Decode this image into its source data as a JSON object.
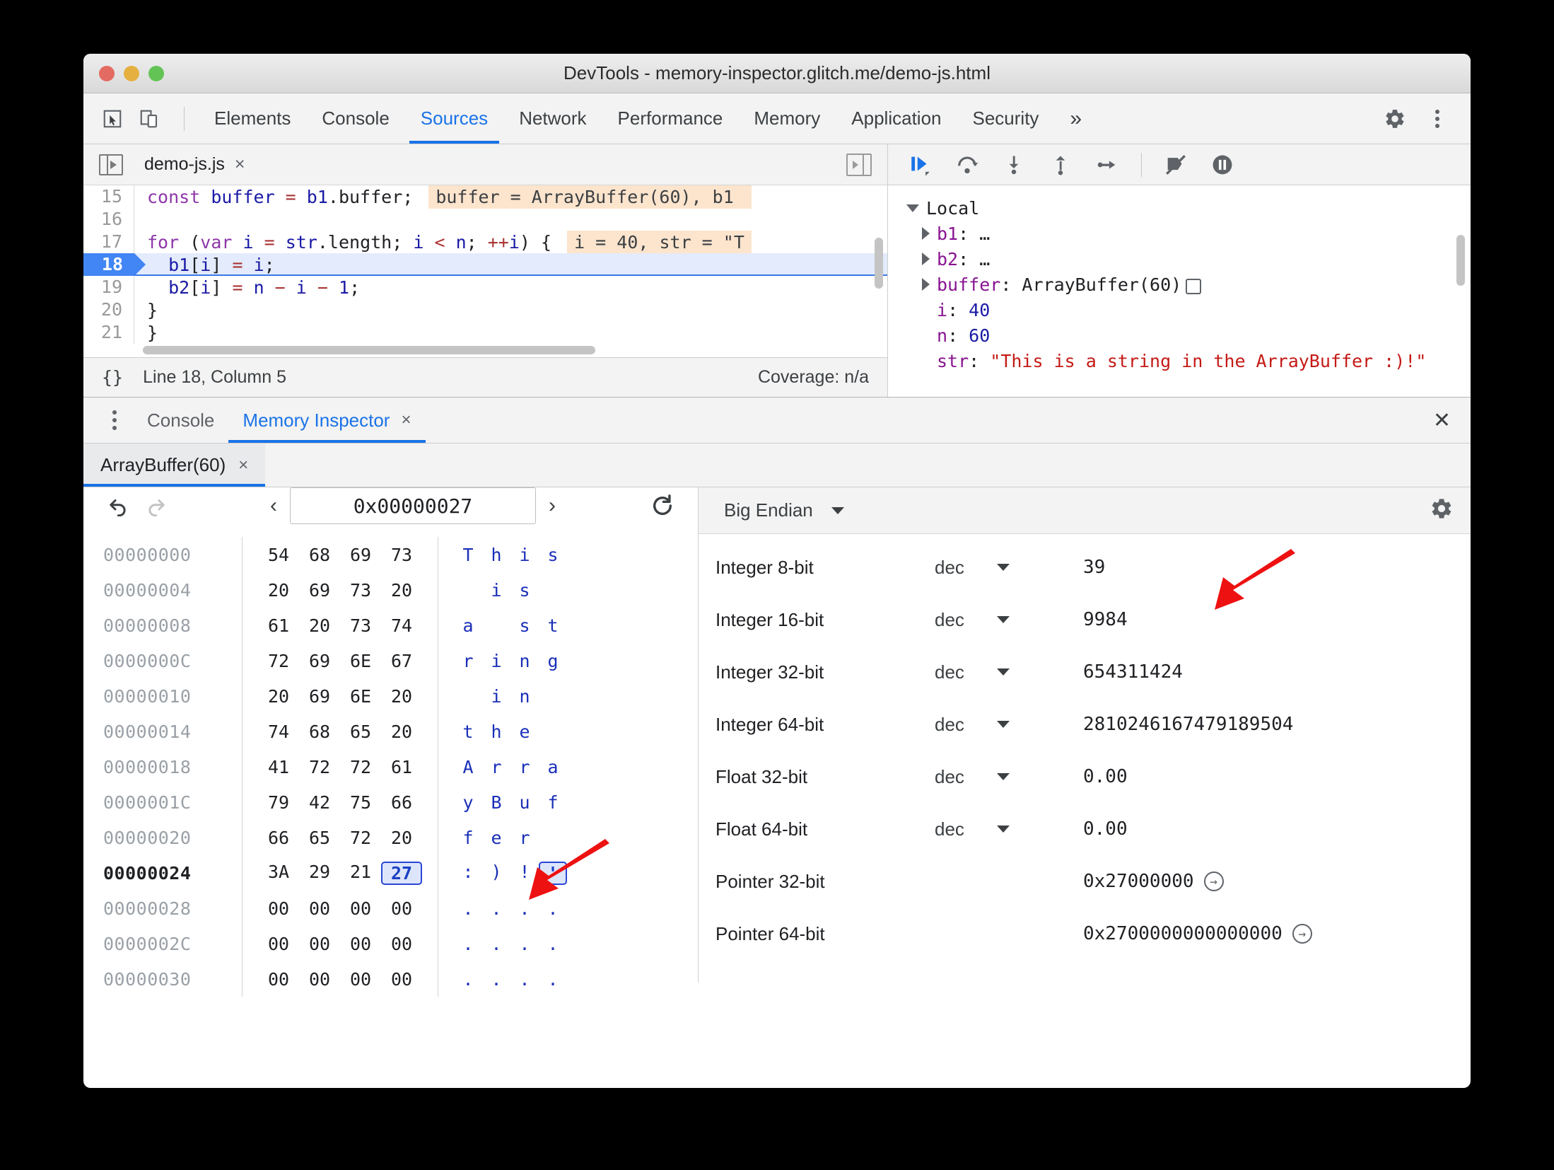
{
  "window": {
    "title": "DevTools - memory-inspector.glitch.me/demo-js.html"
  },
  "toolbar": {
    "inspect_icon": "cursor-select-icon",
    "device_icon": "device-toolbar-icon",
    "tabs": [
      {
        "label": "Elements",
        "active": false
      },
      {
        "label": "Console",
        "active": false
      },
      {
        "label": "Sources",
        "active": true
      },
      {
        "label": "Network",
        "active": false
      },
      {
        "label": "Performance",
        "active": false
      },
      {
        "label": "Memory",
        "active": false
      },
      {
        "label": "Application",
        "active": false
      },
      {
        "label": "Security",
        "active": false
      }
    ],
    "more_tabs": "»",
    "settings_icon": "gear-icon",
    "menu_icon": "kebab-menu-icon"
  },
  "sources": {
    "file_tab": {
      "name": "demo-js.js",
      "close": "×"
    },
    "code_lines": [
      {
        "number": "15",
        "segments": [
          {
            "t": "const ",
            "c": "kw"
          },
          {
            "t": "buffer",
            "c": "var-name"
          },
          {
            "t": " = ",
            "c": "op"
          },
          {
            "t": "b1",
            "c": "var-name"
          },
          {
            "t": ".buffer;",
            "c": "plain"
          }
        ],
        "hint": "buffer = ArrayBuffer(60), b1 ",
        "current": false
      },
      {
        "number": "16",
        "segments": [],
        "hint": "",
        "current": false
      },
      {
        "number": "17",
        "segments": [
          {
            "t": "for ",
            "c": "kw"
          },
          {
            "t": "(",
            "c": "plain"
          },
          {
            "t": "var ",
            "c": "kw"
          },
          {
            "t": "i",
            "c": "var-name"
          },
          {
            "t": " = ",
            "c": "op"
          },
          {
            "t": "str",
            "c": "var-name"
          },
          {
            "t": ".length; ",
            "c": "plain"
          },
          {
            "t": "i",
            "c": "var-name"
          },
          {
            "t": " < ",
            "c": "op"
          },
          {
            "t": "n",
            "c": "var-name"
          },
          {
            "t": "; ",
            "c": "plain"
          },
          {
            "t": "++",
            "c": "op"
          },
          {
            "t": "i",
            "c": "var-name"
          },
          {
            "t": ") {",
            "c": "plain"
          }
        ],
        "hint": "i = 40, str = \"T",
        "current": false
      },
      {
        "number": "18",
        "segments": [
          {
            "t": "  ",
            "c": "plain"
          },
          {
            "t": "b1",
            "c": "var-name"
          },
          {
            "t": "[",
            "c": "plain"
          },
          {
            "t": "i",
            "c": "var-name"
          },
          {
            "t": "] ",
            "c": "plain"
          },
          {
            "t": "= ",
            "c": "op"
          },
          {
            "t": "i",
            "c": "var-name"
          },
          {
            "t": ";",
            "c": "plain"
          }
        ],
        "hint": "",
        "current": true
      },
      {
        "number": "19",
        "segments": [
          {
            "t": "  ",
            "c": "plain"
          },
          {
            "t": "b2",
            "c": "var-name"
          },
          {
            "t": "[",
            "c": "plain"
          },
          {
            "t": "i",
            "c": "var-name"
          },
          {
            "t": "] ",
            "c": "plain"
          },
          {
            "t": "= ",
            "c": "op"
          },
          {
            "t": "n",
            "c": "var-name"
          },
          {
            "t": " − ",
            "c": "op"
          },
          {
            "t": "i",
            "c": "var-name"
          },
          {
            "t": " − ",
            "c": "op"
          },
          {
            "t": "1",
            "c": "num"
          },
          {
            "t": ";",
            "c": "plain"
          }
        ],
        "hint": "",
        "current": false
      },
      {
        "number": "20",
        "segments": [
          {
            "t": "}",
            "c": "plain"
          }
        ],
        "hint": "",
        "current": false
      },
      {
        "number": "21",
        "segments": [
          {
            "t": "}",
            "c": "plain"
          }
        ],
        "hint": "",
        "current": false
      }
    ],
    "status": {
      "format_icon": "{}",
      "position": "Line 18, Column 5",
      "coverage": "Coverage: n/a"
    }
  },
  "debugger": {
    "buttons": [
      "resume-script-icon",
      "step-over-icon",
      "step-into-icon",
      "step-out-icon",
      "step-icon",
      "deactivate-breakpoints-icon",
      "pause-on-exceptions-icon"
    ],
    "scope_title": "Local",
    "scope_rows": [
      {
        "name": "b1",
        "sep": ": ",
        "value": "…",
        "expandable": true,
        "kind": "plain"
      },
      {
        "name": "b2",
        "sep": ": ",
        "value": "…",
        "expandable": true,
        "kind": "plain"
      },
      {
        "name": "buffer",
        "sep": ": ",
        "value": "ArrayBuffer(60)",
        "expandable": true,
        "kind": "plain",
        "memory_icon": true
      },
      {
        "name": "i",
        "sep": ": ",
        "value": "40",
        "expandable": false,
        "kind": "num"
      },
      {
        "name": "n",
        "sep": ": ",
        "value": "60",
        "expandable": false,
        "kind": "num"
      },
      {
        "name": "str",
        "sep": ": ",
        "value": "\"This is a string in the ArrayBuffer :)!\"",
        "expandable": false,
        "kind": "str"
      }
    ]
  },
  "drawer": {
    "tabs": [
      {
        "label": "Console",
        "active": false,
        "closable": false
      },
      {
        "label": "Memory Inspector",
        "active": true,
        "closable": true,
        "close": "×"
      }
    ],
    "close": "✕"
  },
  "memory_inspector": {
    "buffer_tab": {
      "label": "ArrayBuffer(60)",
      "close": "×"
    },
    "toolbar": {
      "undo_icon": "undo-icon",
      "redo_icon": "redo-icon",
      "prev_icon": "‹",
      "next_icon": "›",
      "address_value": "0x00000027",
      "refresh_icon": "refresh-icon"
    },
    "hex_rows": [
      {
        "address": "00000000",
        "bytes": [
          "54",
          "68",
          "69",
          "73"
        ],
        "ascii": [
          "T",
          "h",
          "i",
          "s"
        ],
        "selected_index": -1,
        "highlight": false
      },
      {
        "address": "00000004",
        "bytes": [
          "20",
          "69",
          "73",
          "20"
        ],
        "ascii": [
          " ",
          "i",
          "s",
          " "
        ],
        "selected_index": -1,
        "highlight": false
      },
      {
        "address": "00000008",
        "bytes": [
          "61",
          "20",
          "73",
          "74"
        ],
        "ascii": [
          "a",
          " ",
          "s",
          "t"
        ],
        "selected_index": -1,
        "highlight": false
      },
      {
        "address": "0000000C",
        "bytes": [
          "72",
          "69",
          "6E",
          "67"
        ],
        "ascii": [
          "r",
          "i",
          "n",
          "g"
        ],
        "selected_index": -1,
        "highlight": false
      },
      {
        "address": "00000010",
        "bytes": [
          "20",
          "69",
          "6E",
          "20"
        ],
        "ascii": [
          " ",
          "i",
          "n",
          " "
        ],
        "selected_index": -1,
        "highlight": false
      },
      {
        "address": "00000014",
        "bytes": [
          "74",
          "68",
          "65",
          "20"
        ],
        "ascii": [
          "t",
          "h",
          "e",
          " "
        ],
        "selected_index": -1,
        "highlight": false
      },
      {
        "address": "00000018",
        "bytes": [
          "41",
          "72",
          "72",
          "61"
        ],
        "ascii": [
          "A",
          "r",
          "r",
          "a"
        ],
        "selected_index": -1,
        "highlight": false
      },
      {
        "address": "0000001C",
        "bytes": [
          "79",
          "42",
          "75",
          "66"
        ],
        "ascii": [
          "y",
          "B",
          "u",
          "f"
        ],
        "selected_index": -1,
        "highlight": false
      },
      {
        "address": "00000020",
        "bytes": [
          "66",
          "65",
          "72",
          "20"
        ],
        "ascii": [
          "f",
          "e",
          "r",
          " "
        ],
        "selected_index": -1,
        "highlight": false
      },
      {
        "address": "00000024",
        "bytes": [
          "3A",
          "29",
          "21",
          "27"
        ],
        "ascii": [
          ":",
          ")",
          "!",
          "'"
        ],
        "selected_index": 3,
        "highlight": true
      },
      {
        "address": "00000028",
        "bytes": [
          "00",
          "00",
          "00",
          "00"
        ],
        "ascii": [
          ".",
          ".",
          ".",
          "."
        ],
        "selected_index": -1,
        "highlight": false
      },
      {
        "address": "0000002C",
        "bytes": [
          "00",
          "00",
          "00",
          "00"
        ],
        "ascii": [
          ".",
          ".",
          ".",
          "."
        ],
        "selected_index": -1,
        "highlight": false
      },
      {
        "address": "00000030",
        "bytes": [
          "00",
          "00",
          "00",
          "00"
        ],
        "ascii": [
          ".",
          ".",
          ".",
          "."
        ],
        "selected_index": -1,
        "highlight": false
      }
    ],
    "value_inspector": {
      "endianness": "Big Endian",
      "settings_icon": "gear-icon",
      "rows": [
        {
          "label": "Integer 8-bit",
          "mode": "dec",
          "has_caret": true,
          "value": "39",
          "jump": false
        },
        {
          "label": "Integer 16-bit",
          "mode": "dec",
          "has_caret": true,
          "value": "9984",
          "jump": false
        },
        {
          "label": "Integer 32-bit",
          "mode": "dec",
          "has_caret": true,
          "value": "654311424",
          "jump": false
        },
        {
          "label": "Integer 64-bit",
          "mode": "dec",
          "has_caret": true,
          "value": "2810246167479189504",
          "jump": false
        },
        {
          "label": "Float 32-bit",
          "mode": "dec",
          "has_caret": true,
          "value": "0.00",
          "jump": false
        },
        {
          "label": "Float 64-bit",
          "mode": "dec",
          "has_caret": true,
          "value": "0.00",
          "jump": false
        },
        {
          "label": "Pointer 32-bit",
          "mode": "",
          "has_caret": false,
          "value": "0x27000000",
          "jump": true
        },
        {
          "label": "Pointer 64-bit",
          "mode": "",
          "has_caret": false,
          "value": "0x2700000000000000",
          "jump": true
        }
      ]
    }
  },
  "annotations": {
    "arrow_color": "#ee1111",
    "arrows": [
      {
        "name": "arrow-pointing-to-integer-8bit-value"
      },
      {
        "name": "arrow-pointing-to-selected-ascii-char"
      }
    ]
  }
}
